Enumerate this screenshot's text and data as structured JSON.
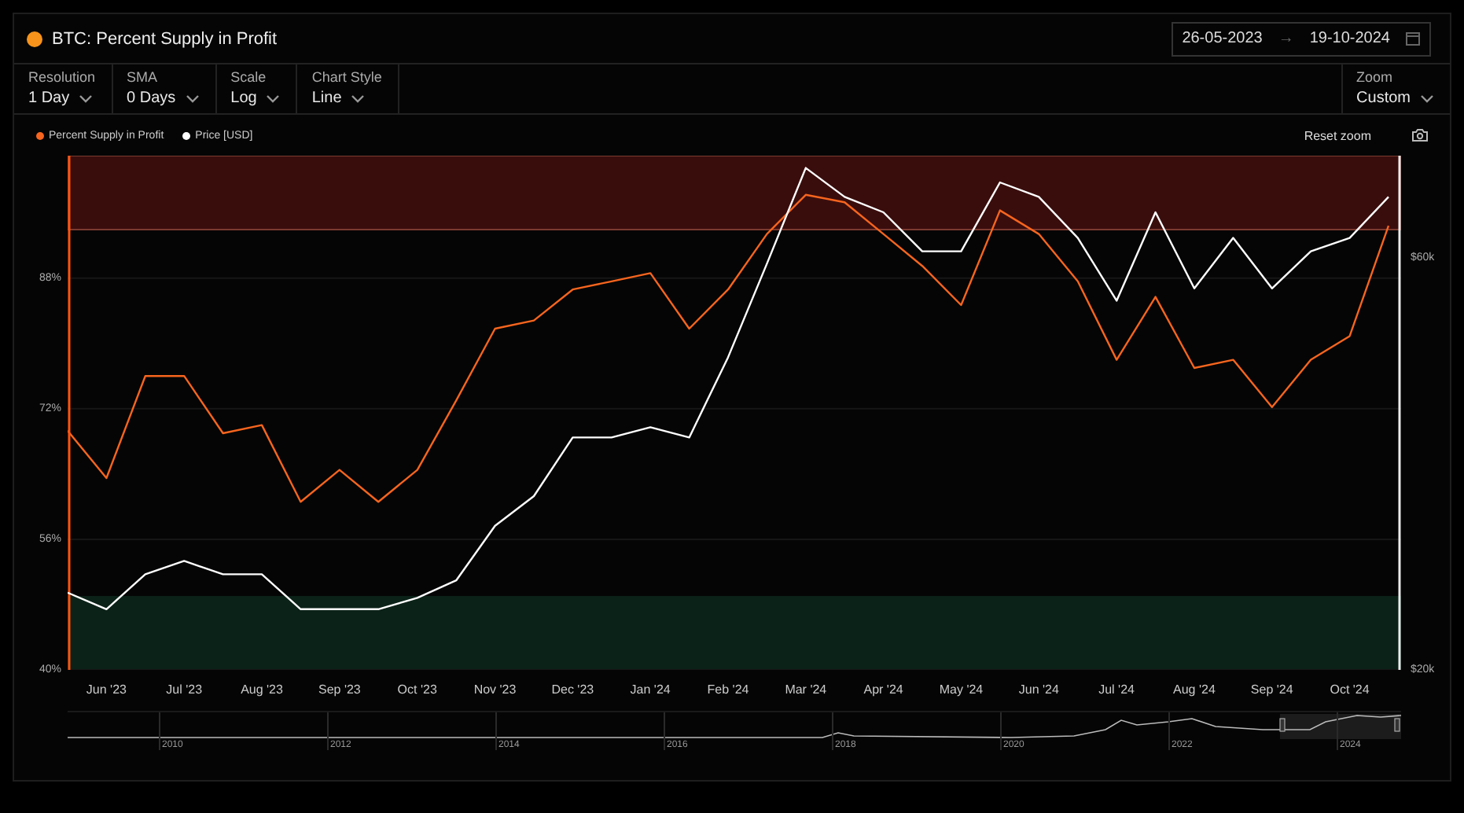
{
  "window": {
    "title": "BTC: Percent Supply in Profit"
  },
  "date_range": {
    "start": "26-05-2023",
    "separator": "→",
    "end": "19-10-2024"
  },
  "controls": [
    {
      "label": "Resolution",
      "value": "1 Day"
    },
    {
      "label": "SMA",
      "value": "0 Days"
    },
    {
      "label": "Scale",
      "value": "Log"
    },
    {
      "label": "Chart Style",
      "value": "Line"
    }
  ],
  "zoom_control": {
    "label": "Zoom",
    "value": "Custom"
  },
  "reset_zoom": "Reset zoom",
  "chart": {
    "chart_data": {
      "type": "line",
      "categories": [
        null,
        "Jun '23",
        null,
        "Jul '23",
        null,
        "Aug '23",
        null,
        "Sep '23",
        null,
        "Oct '23",
        null,
        "Nov '23",
        null,
        "Dec '23",
        null,
        "Jan '24",
        null,
        "Feb '24",
        null,
        "Mar '24",
        null,
        "Apr '24",
        null,
        "May '24",
        null,
        "Jun '24",
        null,
        "Jul '24",
        null,
        "Aug '24",
        null,
        "Sep '24",
        null,
        "Oct '24",
        null
      ],
      "ylim": [
        40,
        103
      ],
      "yticks": [
        {
          "value": 88,
          "label": "88%"
        },
        {
          "value": 72,
          "label": "72%"
        },
        {
          "value": 56,
          "label": "56%"
        },
        {
          "value": 40,
          "label": "40%"
        }
      ],
      "series": [
        {
          "name": "Percent Supply in Profit",
          "color": "#f7651e",
          "values": [
            69.3,
            63.5,
            76,
            76,
            69,
            70,
            60.6,
            64.5,
            60.6,
            64.5,
            73,
            81.8,
            82.8,
            86.6,
            87.6,
            88.6,
            81.8,
            86.6,
            93.4,
            98.2,
            97.3,
            93.4,
            89.5,
            84.7,
            96.3,
            93.4,
            87.6,
            78,
            85.7,
            77,
            78,
            72.2,
            78,
            80.9,
            94.4
          ]
        }
      ],
      "grid": true
    }
  },
  "price_chart": {
    "chart_data": {
      "type": "line",
      "ylim": [
        20000,
        70000
      ],
      "yticks": [
        {
          "value": 60000,
          "label": "$60k"
        },
        {
          "value": 20000,
          "label": "$20k"
        }
      ],
      "series": [
        {
          "name": "Price [USD]",
          "color": "#ffffff",
          "values": [
            27500,
            25900,
            29300,
            30600,
            29300,
            29300,
            25900,
            25900,
            25900,
            27000,
            28700,
            34000,
            36900,
            42600,
            42600,
            43600,
            42600,
            50400,
            59500,
            68800,
            66000,
            64500,
            60700,
            60700,
            67400,
            66000,
            62000,
            55900,
            64500,
            57100,
            62000,
            57100,
            60700,
            62000,
            66000
          ]
        }
      ]
    }
  },
  "navigator": {
    "years": [
      "2010",
      "2012",
      "2014",
      "2016",
      "2018",
      "2020",
      "2022",
      "2024"
    ]
  }
}
